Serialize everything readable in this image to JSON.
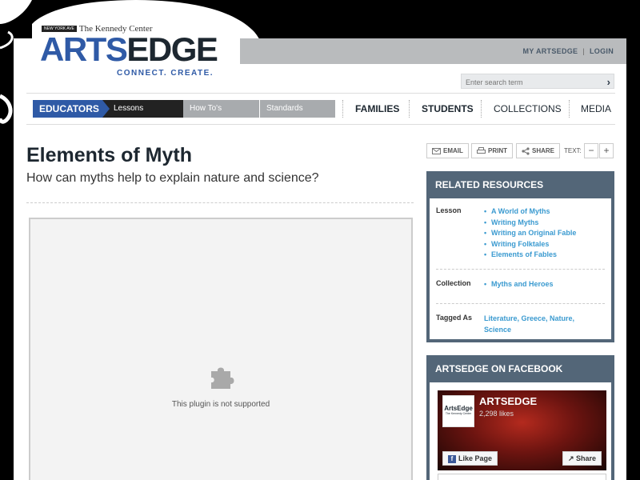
{
  "brand": {
    "org_tag": "NEW YORK AVE",
    "org_name": "The Kennedy Center",
    "name_part1": "ARTS",
    "name_part2": "EDGE",
    "tagline": "CONNECT. CREATE.",
    "colors": {
      "blue": "#2f5aa6",
      "dark": "#1d2730",
      "slate": "#536678",
      "link": "#3a9ad0"
    }
  },
  "top_links": {
    "my_artsedge": "MY ARTSEDGE",
    "separator": "|",
    "login": "LOGIN"
  },
  "search": {
    "placeholder": "Enter search term",
    "icon": "chevron-right-icon"
  },
  "nav": {
    "educators": "EDUCATORS",
    "sub": [
      "Lessons",
      "How To's",
      "Standards"
    ],
    "main": [
      "FAMILIES",
      "STUDENTS",
      "COLLECTIONS",
      "MEDIA"
    ]
  },
  "article": {
    "title": "Elements of Myth",
    "subtitle": "How can myths help to explain nature and science?",
    "plugin_message": "This plugin is not supported"
  },
  "tools": {
    "email": "EMAIL",
    "print": "PRINT",
    "share": "SHARE",
    "text_label": "TEXT:",
    "minus": "−",
    "plus": "+"
  },
  "related": {
    "heading": "RELATED RESOURCES",
    "lesson_label": "Lesson",
    "lessons": [
      "A World of Myths",
      "Writing Myths",
      "Writing an Original Fable",
      "Writing Folktales",
      "Elements of Fables"
    ],
    "collection_label": "Collection",
    "collections": [
      "Myths and Heroes"
    ],
    "tagged_label": "Tagged As",
    "tags": "Literature, Greece, Nature, Science"
  },
  "facebook": {
    "heading": "ARTSEDGE ON FACEBOOK",
    "page_name": "ARTSEDGE",
    "likes": "2,298 likes",
    "logo_text": "ArtsEdge",
    "logo_sub": "The Kennedy Center",
    "like_button": "Like Page",
    "share_button": "Share"
  }
}
